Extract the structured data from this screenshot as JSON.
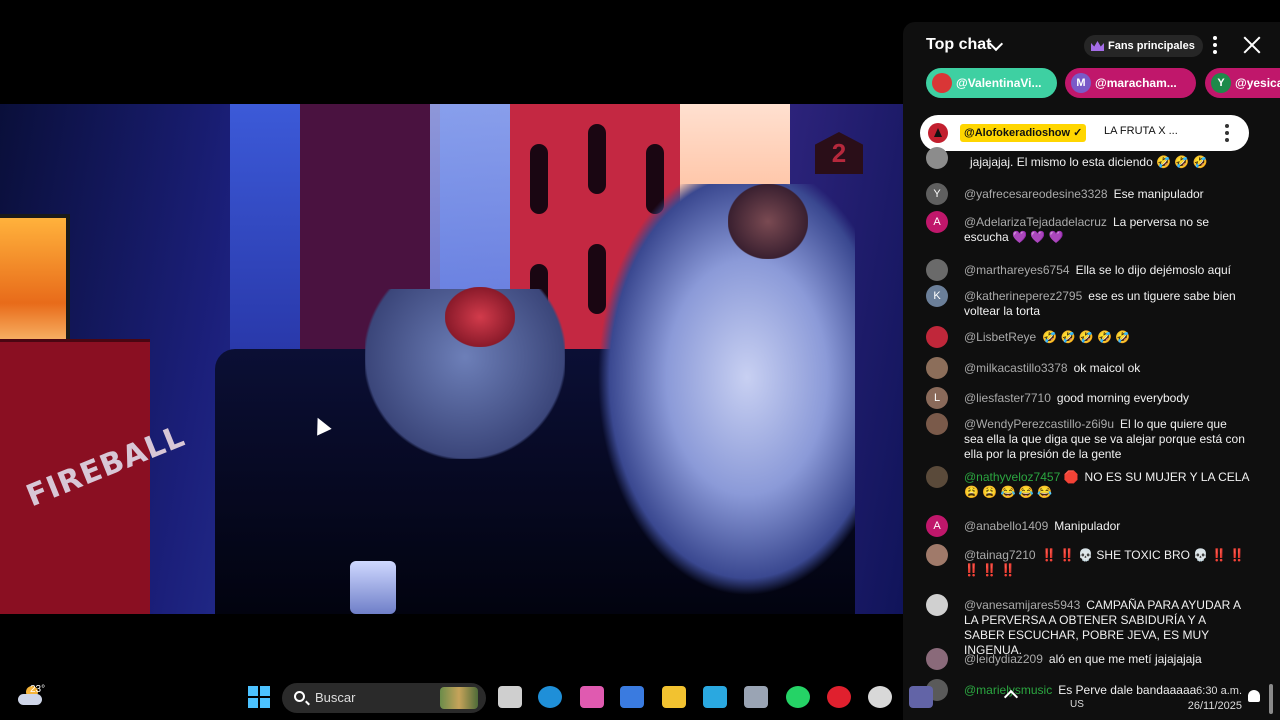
{
  "chat": {
    "title": "Top chat",
    "fans_label": "Fans principales",
    "pills": [
      {
        "name": "@ValentinaVi...",
        "bg": "#3ed0a2",
        "avatar_color": "#d93636",
        "initial": ""
      },
      {
        "name": "@maracham...",
        "bg": "#c0176b",
        "avatar_color": "#7a5ac8",
        "initial": "M"
      },
      {
        "name": "@yesica",
        "bg": "#c0176b",
        "avatar_color": "#1e8a4a",
        "initial": "Y"
      }
    ],
    "pinned": {
      "author": "@Alofokeradioshow ✓",
      "text": "LA FRUTA X ..."
    },
    "messages": [
      {
        "initial": "",
        "avatar_color": "#8c8c8c",
        "author": "",
        "author_style": "",
        "text": "jajajajaj. El mismo lo esta diciendo 🤣 🤣 🤣"
      },
      {
        "initial": "Y",
        "avatar_color": "#5f5f5f",
        "author": "@yafrecesareodesine3328",
        "author_style": "",
        "text": "Ese manipulador"
      },
      {
        "initial": "A",
        "avatar_color": "#c0176b",
        "author": "@AdelarizaTejadadelacruz",
        "author_style": "",
        "text": "La perversa no se escucha 💜 💜 💜"
      },
      {
        "initial": "",
        "avatar_color": "#6a6a6a",
        "author": "@marthareyes6754",
        "author_style": "",
        "text": "Ella se lo dijo dejémoslo aquí"
      },
      {
        "initial": "K",
        "avatar_color": "#6b7f99",
        "author": "@katherineperez2795",
        "author_style": "",
        "text": "ese es un tiguere sabe bien voltear la torta"
      },
      {
        "initial": "",
        "avatar_color": "#c0273a",
        "author": "@LisbetReye",
        "author_style": "",
        "text": "🤣 🤣 🤣 🤣 🤣"
      },
      {
        "initial": "",
        "avatar_color": "#8c6e5a",
        "author": "@milkacastillo3378",
        "author_style": "",
        "text": "ok maicol ok"
      },
      {
        "initial": "L",
        "avatar_color": "#8a6a5a",
        "author": "@liesfaster7710",
        "author_style": "",
        "text": "good morning everybody"
      },
      {
        "initial": "",
        "avatar_color": "#7a5a4a",
        "author": "@WendyPerezcastillo-z6i9u",
        "author_style": "",
        "text": "El lo que quiere que sea ella la que diga que se va alejar porque está con ella por la presión de la gente"
      },
      {
        "initial": "",
        "avatar_color": "#5a4a3a",
        "author": "@nathyveloz7457 🛑",
        "author_style": "green",
        "text": "NO ES SU MUJER Y LA CELA 😩 😩 😂 😂 😂"
      },
      {
        "initial": "A",
        "avatar_color": "#c0176b",
        "author": "@anabello1409",
        "author_style": "",
        "text": "Manipulador"
      },
      {
        "initial": "",
        "avatar_color": "#a07a6a",
        "author": "@tainag7210",
        "author_style": "",
        "text": "‼️ ‼️ 💀 SHE TOXIC BRO 💀 ‼️ ‼️ ‼️ ‼️ ‼️"
      },
      {
        "initial": "",
        "avatar_color": "#d0d0d0",
        "author": "@vanesamijares5943",
        "author_style": "",
        "text": "CAMPAÑA PARA AYUDAR A LA PERVERSA A OBTENER SABIDURÍA Y A SABER ESCUCHAR, POBRE JEVA, ES MUY INGENUA."
      },
      {
        "initial": "",
        "avatar_color": "#8a6a7a",
        "author": "@leidydiaz209",
        "author_style": "",
        "text": "aló en que me metí jajajajaja"
      },
      {
        "initial": "",
        "avatar_color": "#5a5a5a",
        "author": "@marielysmusic",
        "author_style": "green",
        "text": "Es Perve dale bandaaaaa"
      }
    ]
  },
  "video": {
    "sign_text": "FIREBALL",
    "badge_text": "2"
  },
  "taskbar": {
    "temperature": "23°",
    "search_placeholder": "Buscar",
    "icons": [
      "task-view-icon",
      "edge-icon",
      "copilot-icon",
      "store-icon",
      "file-explorer-icon",
      "app-icon",
      "settings-icon",
      "whatsapp-icon",
      "opera-icon",
      "obs-icon",
      "teams-icon"
    ],
    "language": "US",
    "time": "6:30 a.m.",
    "date": "26/11/2025"
  }
}
